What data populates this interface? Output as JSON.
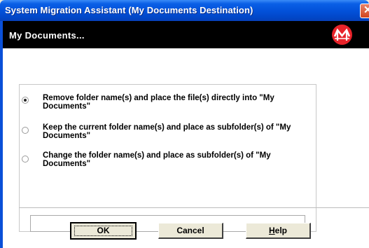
{
  "window": {
    "title": "System Migration Assistant (My Documents Destination)",
    "close_glyph": "✕"
  },
  "header": {
    "title": "My Documents...",
    "logo_icon": "m-logo-icon",
    "logo_color": "#E8232A"
  },
  "options": [
    {
      "label": "Remove folder name(s) and place the file(s) directly into \"My Documents\"",
      "checked": true
    },
    {
      "label": "Keep the current folder name(s) and place as subfolder(s) of \"My Documents\"",
      "checked": false
    },
    {
      "label": "Change the folder name(s) and place as subfolder(s) of \"My Documents\"",
      "checked": false
    }
  ],
  "folder_name": {
    "value": "",
    "placeholder": ""
  },
  "buttons": {
    "ok": "OK",
    "cancel": "Cancel",
    "help_mnemonic": "H",
    "help_rest": "elp"
  },
  "colors": {
    "titlebar": "#0250D8",
    "header_band": "#000000",
    "dialog_face": "#ECE9D8"
  }
}
